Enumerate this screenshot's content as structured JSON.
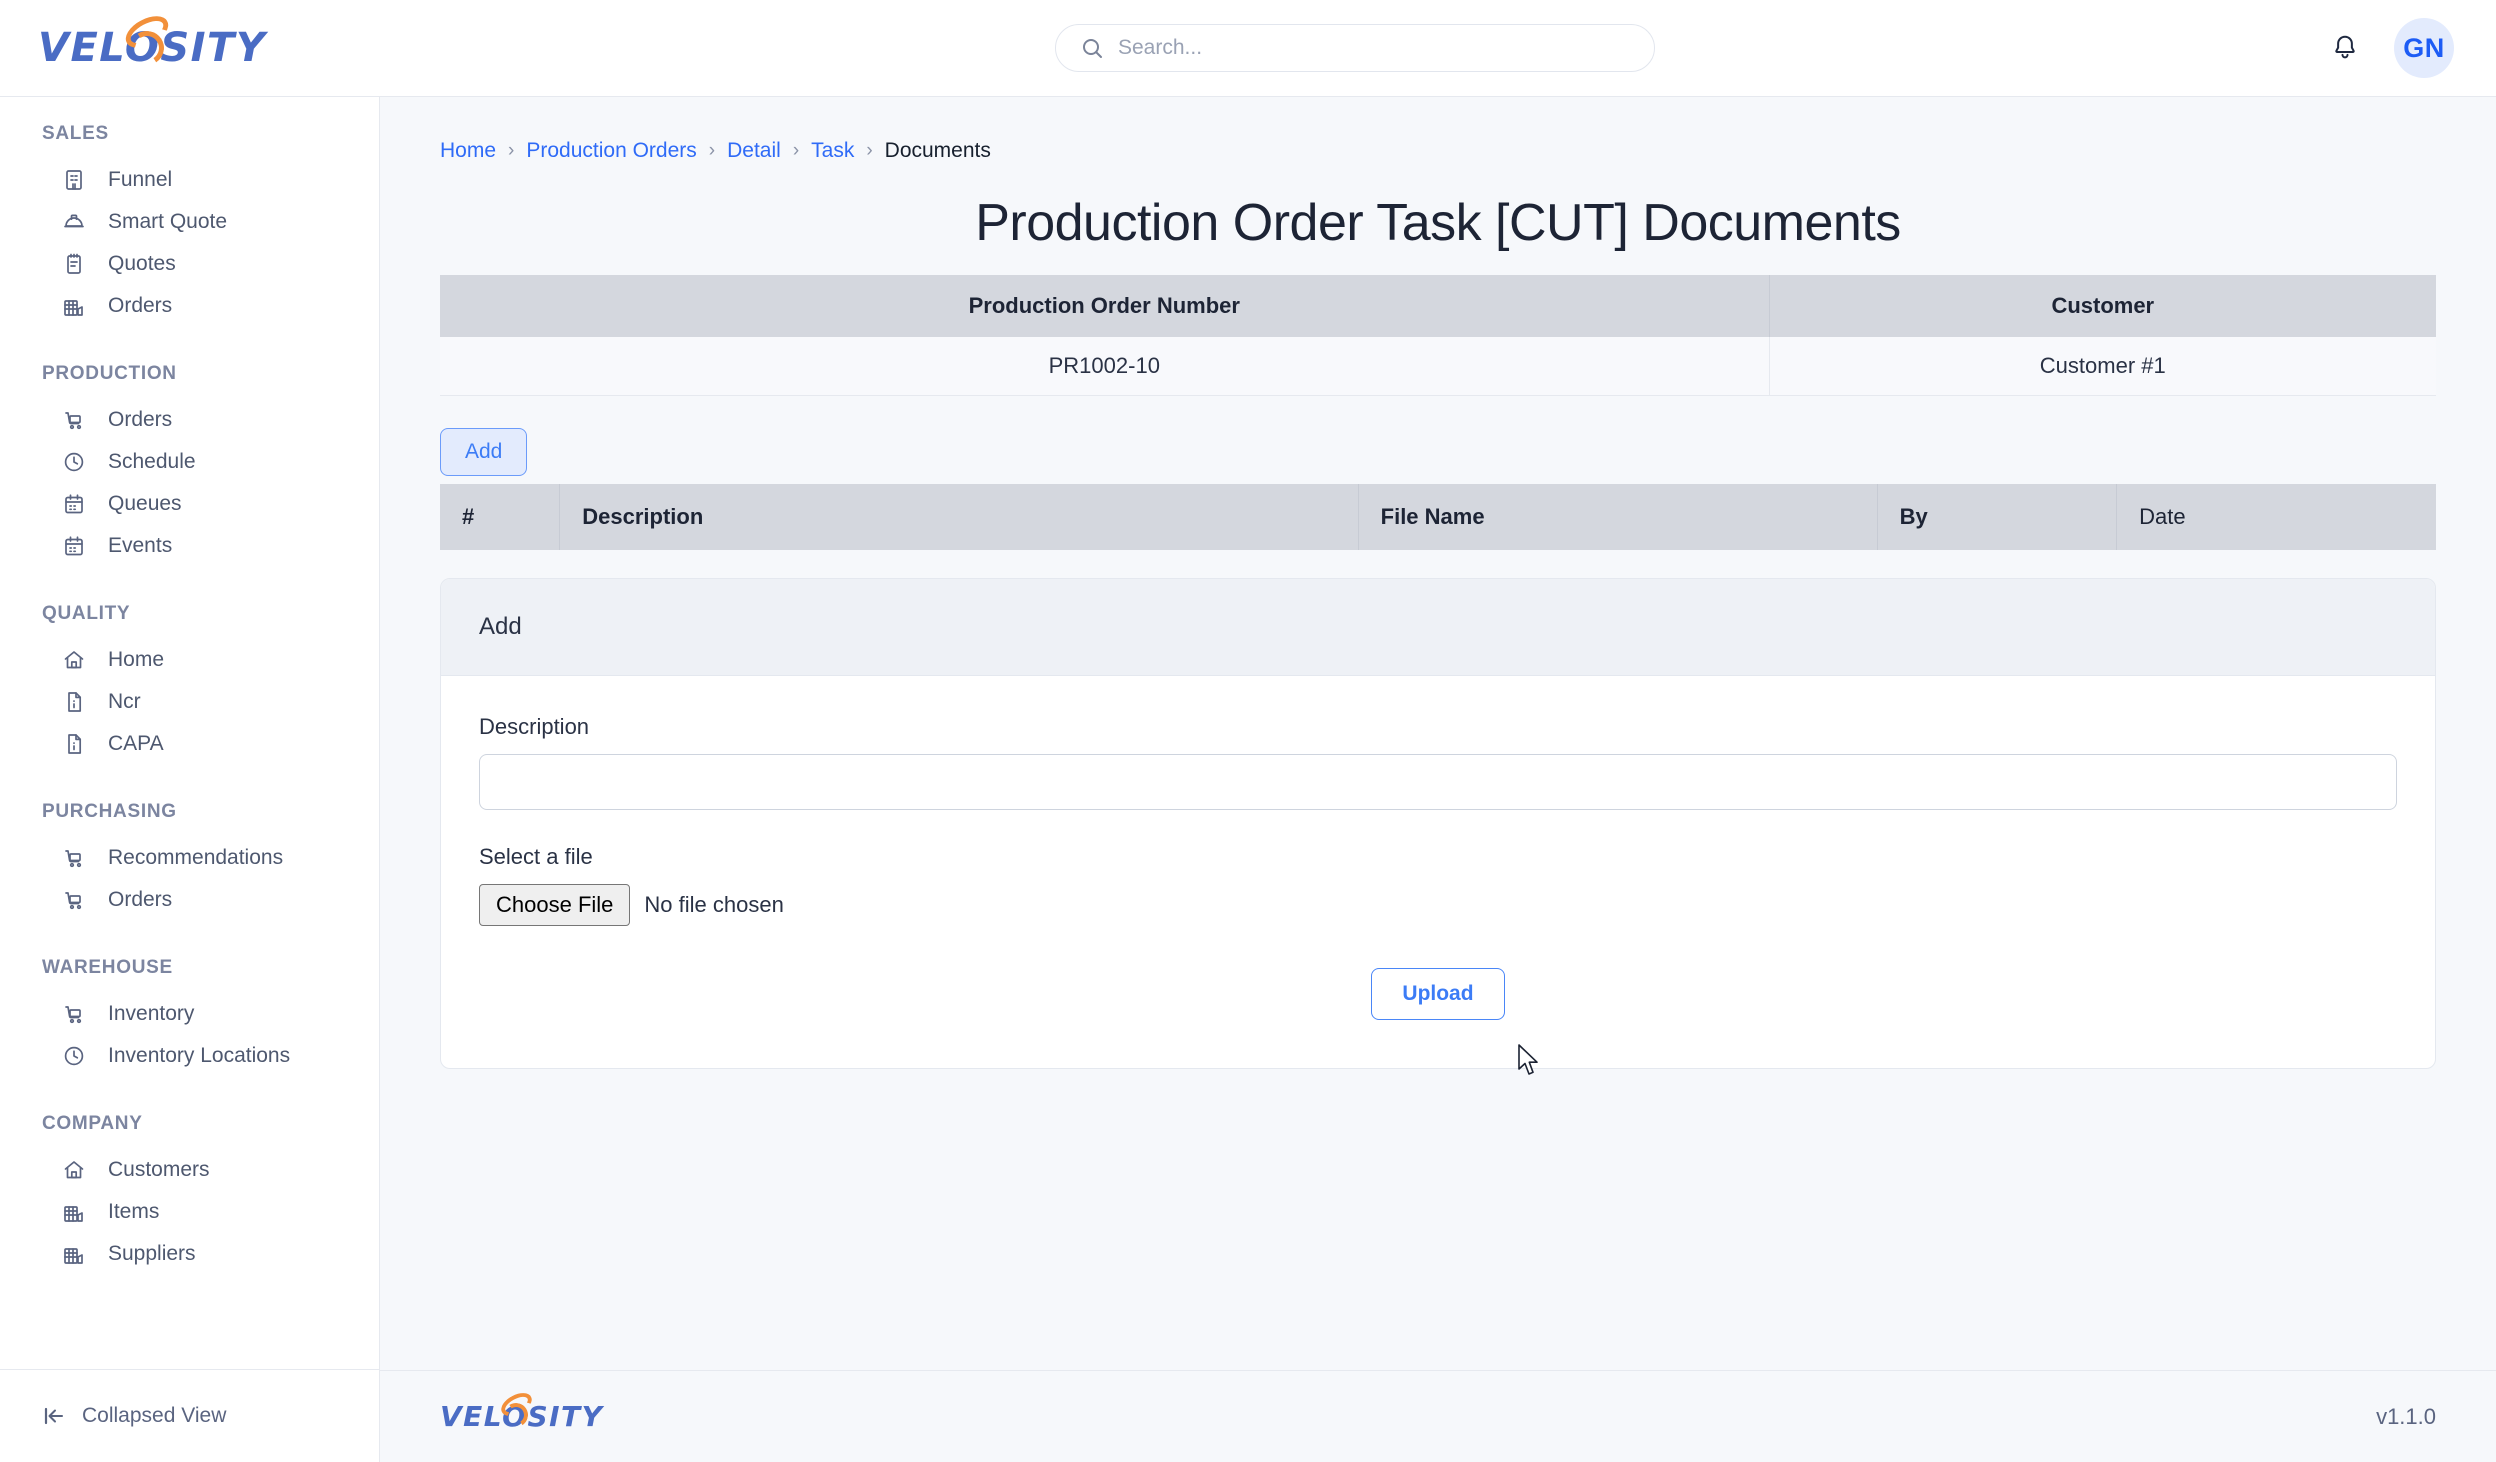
{
  "brand": {
    "name": "VELOSITY",
    "accent_blue": "#4a6cc4",
    "accent_orange": "#f2903a"
  },
  "header": {
    "search": {
      "placeholder": "Search...",
      "value": "",
      "icon": "search-icon"
    },
    "notification_icon": "bell-icon",
    "avatar_initials": "GN"
  },
  "sidebar": {
    "groups": [
      {
        "title": "SALES",
        "items": [
          {
            "label": "Funnel",
            "icon": "building-icon"
          },
          {
            "label": "Smart Quote",
            "icon": "hardhat-icon"
          },
          {
            "label": "Quotes",
            "icon": "clipboard-icon"
          },
          {
            "label": "Orders",
            "icon": "factory-icon"
          }
        ]
      },
      {
        "title": "PRODUCTION",
        "items": [
          {
            "label": "Orders",
            "icon": "cart-icon"
          },
          {
            "label": "Schedule",
            "icon": "clock-icon"
          },
          {
            "label": "Queues",
            "icon": "calendar-icon"
          },
          {
            "label": "Events",
            "icon": "calendar-icon"
          }
        ]
      },
      {
        "title": "QUALITY",
        "items": [
          {
            "label": "Home",
            "icon": "home-icon"
          },
          {
            "label": "Ncr",
            "icon": "file-icon"
          },
          {
            "label": "CAPA",
            "icon": "file-icon"
          }
        ]
      },
      {
        "title": "PURCHASING",
        "items": [
          {
            "label": "Recommendations",
            "icon": "cart-icon"
          },
          {
            "label": "Orders",
            "icon": "cart-icon"
          }
        ]
      },
      {
        "title": "WAREHOUSE",
        "items": [
          {
            "label": "Inventory",
            "icon": "cart-icon"
          },
          {
            "label": "Inventory Locations",
            "icon": "clock-icon"
          }
        ]
      },
      {
        "title": "COMPANY",
        "items": [
          {
            "label": "Customers",
            "icon": "home-icon"
          },
          {
            "label": "Items",
            "icon": "factory-icon"
          },
          {
            "label": "Suppliers",
            "icon": "factory-icon"
          }
        ]
      }
    ],
    "collapse": {
      "label": "Collapsed View",
      "icon": "collapse-left-icon"
    }
  },
  "breadcrumb": {
    "items": [
      {
        "label": "Home",
        "current": false
      },
      {
        "label": "Production Orders",
        "current": false
      },
      {
        "label": "Detail",
        "current": false
      },
      {
        "label": "Task",
        "current": false
      },
      {
        "label": "Documents",
        "current": true
      }
    ],
    "separator": "›"
  },
  "page": {
    "title": "Production Order Task [CUT] Documents"
  },
  "info_table": {
    "headers": [
      "Production Order Number",
      "Customer"
    ],
    "rows": [
      [
        "PR1002-10",
        "Customer #1"
      ]
    ]
  },
  "toolbar": {
    "add_label": "Add"
  },
  "documents_table": {
    "headers": [
      {
        "label": "#",
        "bold": true
      },
      {
        "label": "Description",
        "bold": true
      },
      {
        "label": "File Name",
        "bold": true
      },
      {
        "label": "By",
        "bold": true
      },
      {
        "label": "Date",
        "bold": false
      }
    ],
    "rows": []
  },
  "add_card": {
    "title": "Add",
    "description_label": "Description",
    "description_value": "",
    "file_label": "Select a file",
    "choose_file_label": "Choose File",
    "no_file_text": "No file chosen",
    "upload_label": "Upload"
  },
  "footer": {
    "version": "v1.1.0"
  }
}
